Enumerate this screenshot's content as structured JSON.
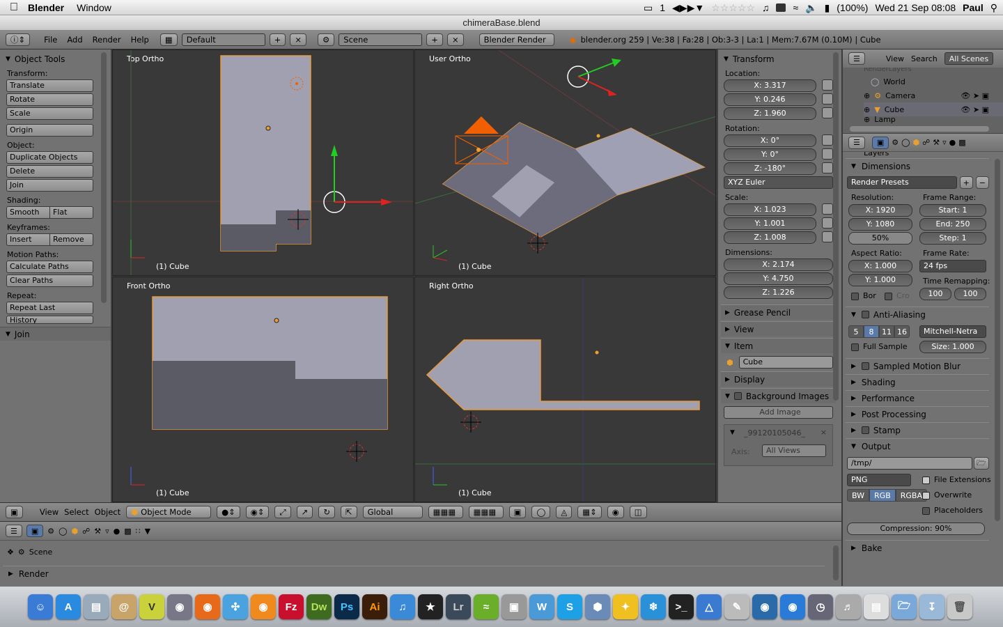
{
  "menubar": {
    "app": "Blender",
    "items": [
      "Window"
    ],
    "status": {
      "battery": "(100%)",
      "datetime": "Wed 21 Sep  08:08",
      "user": "Paul",
      "notifications": "1"
    }
  },
  "window": {
    "title": "chimeraBase.blend"
  },
  "topbar": {
    "menus": [
      "File",
      "Add",
      "Render",
      "Help"
    ],
    "layout": "Default",
    "scene": "Scene",
    "engine": "Blender Render",
    "stats": "blender.org 259 | Ve:38 | Fa:28 | Ob:3-3 | La:1 | Mem:7.67M (0.10M) | Cube"
  },
  "tools": {
    "title": "Object Tools",
    "transform_label": "Transform:",
    "translate": "Translate",
    "rotate": "Rotate",
    "scale": "Scale",
    "origin": "Origin",
    "object_label": "Object:",
    "duplicate": "Duplicate Objects",
    "delete": "Delete",
    "join": "Join",
    "shading_label": "Shading:",
    "smooth": "Smooth",
    "flat": "Flat",
    "keyframes_label": "Keyframes:",
    "insert": "Insert",
    "remove": "Remove",
    "motion_label": "Motion Paths:",
    "calc_paths": "Calculate Paths",
    "clear_paths": "Clear Paths",
    "repeat_label": "Repeat:",
    "repeat_last": "Repeat Last",
    "history": "History",
    "join_panel": "Join"
  },
  "viewports": {
    "top": {
      "title": "Top Ortho",
      "footer": "(1) Cube"
    },
    "user": {
      "title": "User Ortho",
      "footer": "(1) Cube"
    },
    "front": {
      "title": "Front Ortho",
      "footer": "(1) Cube"
    },
    "right": {
      "title": "Right Ortho",
      "footer": "(1) Cube"
    }
  },
  "transform": {
    "title": "Transform",
    "location_label": "Location:",
    "loc_x": "X: 3.317",
    "loc_y": "Y: 0.246",
    "loc_z": "Z: 1.960",
    "rotation_label": "Rotation:",
    "rot_x": "X: 0°",
    "rot_y": "Y: 0°",
    "rot_z": "Z: -180°",
    "rot_mode": "XYZ Euler",
    "scale_label": "Scale:",
    "sc_x": "X: 1.023",
    "sc_y": "Y: 1.001",
    "sc_z": "Z: 1.008",
    "dim_label": "Dimensions:",
    "dim_x": "X: 2.174",
    "dim_y": "Y: 4.750",
    "dim_z": "Z: 1.226",
    "grease": "Grease Pencil",
    "view": "View",
    "item": "Item",
    "item_name": "Cube",
    "display": "Display",
    "bg_images": "Background Images",
    "add_image": "Add Image",
    "image_name": "_99120105046_",
    "axis_label": "Axis:",
    "axis_value": "All Views"
  },
  "outliner": {
    "view": "View",
    "search": "Search",
    "filter": "All Scenes",
    "layers": "RenderLayers",
    "items": [
      "World",
      "Camera",
      "Cube",
      "Lamp"
    ]
  },
  "render": {
    "layers": "Layers",
    "dimensions": "Dimensions",
    "presets": "Render Presets",
    "resolution_label": "Resolution:",
    "res_x": "X: 1920",
    "res_y": "Y: 1080",
    "res_pct": "50%",
    "frame_range_label": "Frame Range:",
    "start": "Start: 1",
    "end": "End: 250",
    "step": "Step: 1",
    "aspect_label": "Aspect Ratio:",
    "asp_x": "X: 1.000",
    "asp_y": "Y: 1.000",
    "frame_rate_label": "Frame Rate:",
    "fps": "24 fps",
    "remap_label": "Time Remapping:",
    "remap_old": "100",
    "remap_new": "100",
    "bor": "Bor",
    "cro": "Cro",
    "anti_aliasing": "Anti-Aliasing",
    "aa_samples": [
      "5",
      "8",
      "11",
      "16"
    ],
    "aa_filter": "Mitchell-Netra",
    "full_sample": "Full Sample",
    "size": "Size: 1.000",
    "smb": "Sampled Motion Blur",
    "shading": "Shading",
    "performance": "Performance",
    "post": "Post Processing",
    "stamp": "Stamp",
    "output": "Output",
    "path": "/tmp/",
    "format": "PNG",
    "file_ext": "File Extensions",
    "bw": "BW",
    "rgb": "RGB",
    "rgba": "RGBA",
    "overwrite": "Overwrite",
    "placeholders": "Placeholders",
    "compression": "Compression: 90%",
    "bake": "Bake"
  },
  "vpheader": {
    "view": "View",
    "select": "Select",
    "object": "Object",
    "mode": "Object Mode",
    "orientation": "Global"
  },
  "bottom": {
    "scene": "Scene",
    "render": "Render"
  },
  "dock": {
    "apps": [
      "Finder",
      "App Store",
      "Preview",
      "Contacts",
      "Vectorworks",
      "Disk",
      "Firefox",
      "Safari",
      "Blender",
      "FileZilla",
      "Dw",
      "Ps",
      "Ai",
      "iTunes",
      "iMovie",
      "Lr",
      "Spotify",
      "Camera",
      "Word",
      "Skype",
      "VirtualBox",
      "Twitter",
      "Sketch",
      "Terminal",
      "Geometry",
      "Pen",
      "QuickTime",
      "Network",
      "Clock",
      "Audio",
      "Notes",
      "Folder",
      "Downloads",
      "Trash"
    ]
  }
}
